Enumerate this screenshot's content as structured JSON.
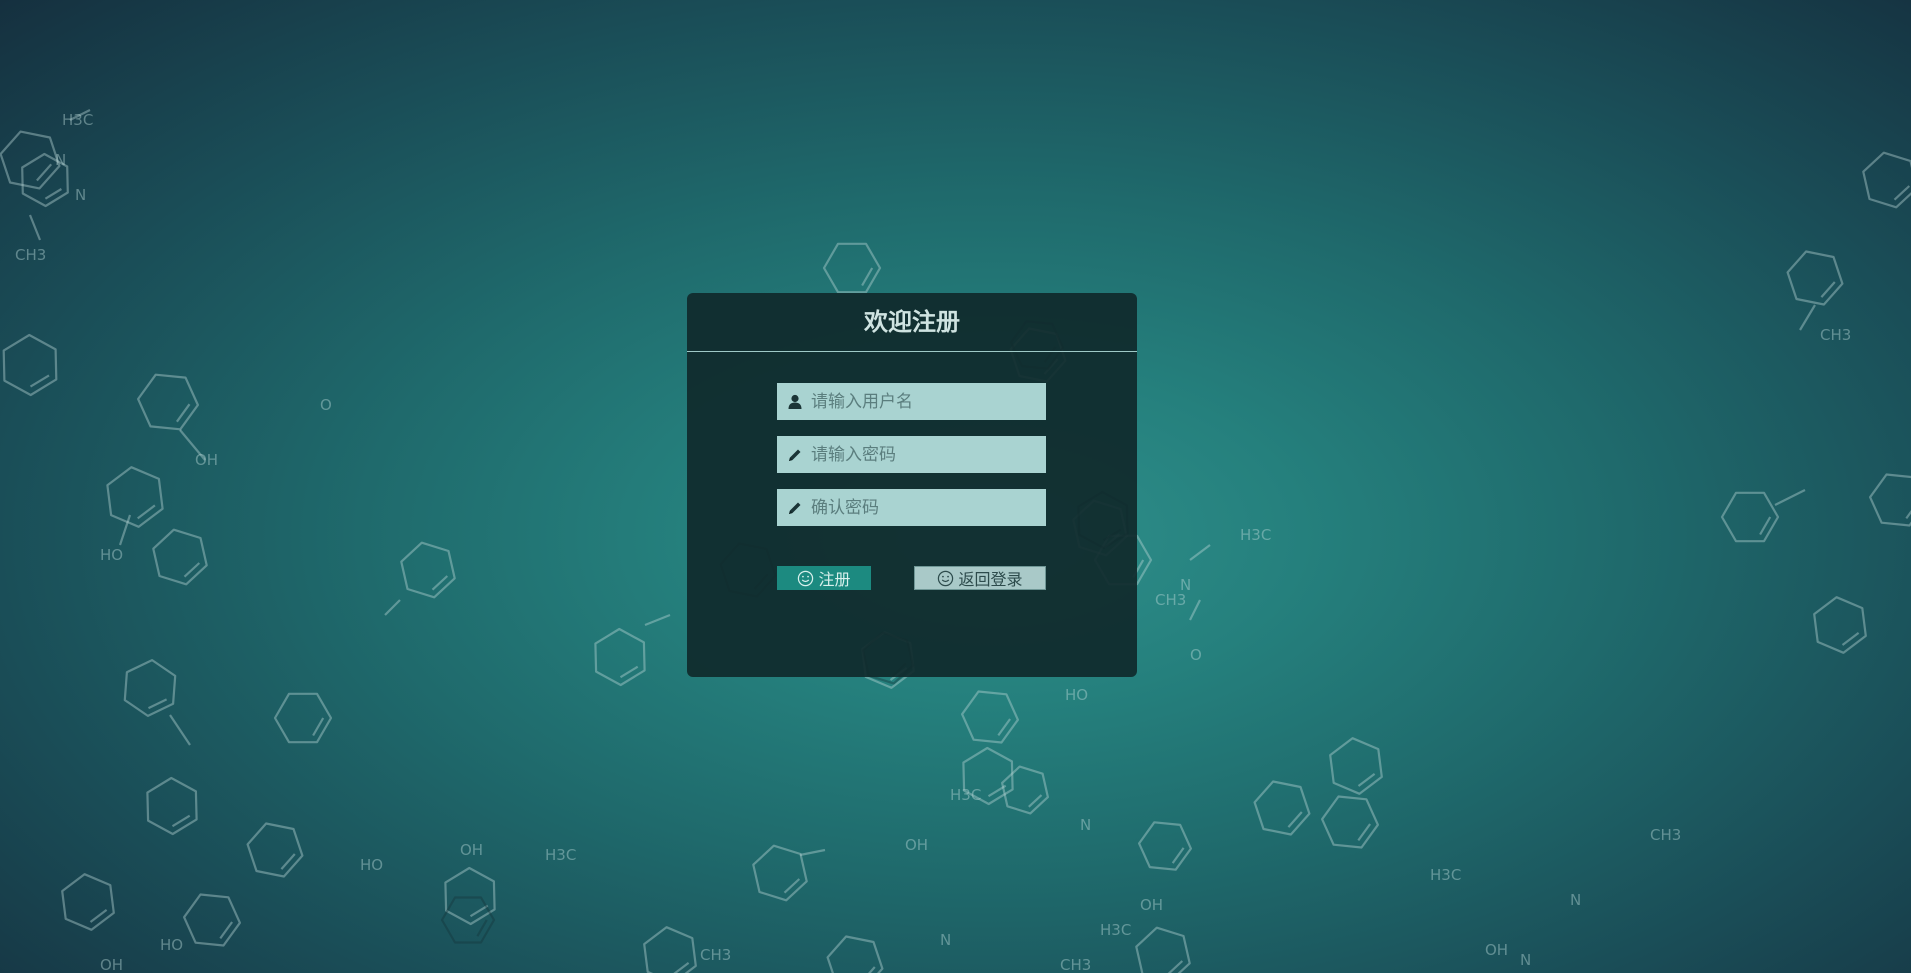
{
  "register_panel": {
    "title": "欢迎注册",
    "username": {
      "placeholder": "请输入用户名",
      "value": "",
      "icon": "user-icon"
    },
    "password": {
      "placeholder": "请输入密码",
      "value": "",
      "icon": "pencil-icon"
    },
    "confirm_password": {
      "placeholder": "确认密码",
      "value": "",
      "icon": "pencil-icon"
    },
    "register_button": {
      "label": "注册",
      "icon": "smiley-icon"
    },
    "back_button": {
      "label": "返回登录",
      "icon": "smiley-icon"
    }
  },
  "background": {
    "description_icon": "molecule-pattern",
    "labels": [
      "H3C",
      "N",
      "N",
      "CH3",
      "O",
      "HO",
      "OH",
      "H3C",
      "N",
      "O",
      "CH3",
      "OH",
      "HO",
      "H3C",
      "N",
      "CH3",
      "OH",
      "HO",
      "OH",
      "H3C",
      "N",
      "N",
      "CH3",
      "OH",
      "H3C",
      "N",
      "CH3",
      "OH",
      "HO",
      "H3C",
      "CH3"
    ]
  },
  "colors": {
    "panel_bg": "#102a2c",
    "field_bg": "#a9d3d1",
    "register_btn": "#1c8a80",
    "back_btn": "#a9c9c8",
    "title": "#cfe3e1"
  }
}
